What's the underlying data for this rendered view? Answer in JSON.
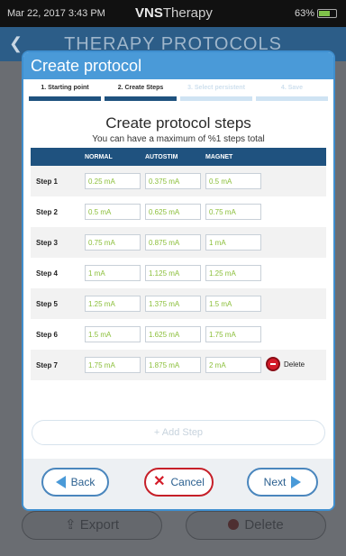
{
  "status_bar": {
    "datetime": "Mar 22, 2017  3:43 PM",
    "brand_prefix": "VNS",
    "brand_suffix": "Therapy",
    "battery": "63%"
  },
  "background": {
    "title": "THERAPY PROTOCOLS",
    "export_label": "Export",
    "delete_label": "Delete"
  },
  "modal": {
    "title": "Create protocol",
    "wizard_steps": [
      "1. Starting point",
      "2. Create Steps",
      "3. Select persistent",
      "4. Save"
    ],
    "heading": "Create protocol steps",
    "subheading": "You can have a maximum of %1 steps total",
    "columns": [
      "NORMAL",
      "AUTOSTIM",
      "MAGNET"
    ],
    "rows": [
      {
        "label": "Step 1",
        "normal": "0.25 mA",
        "autostim": "0.375 mA",
        "magnet": "0.5 mA"
      },
      {
        "label": "Step 2",
        "normal": "0.5 mA",
        "autostim": "0.625 mA",
        "magnet": "0.75 mA"
      },
      {
        "label": "Step 3",
        "normal": "0.75 mA",
        "autostim": "0.875 mA",
        "magnet": "1 mA"
      },
      {
        "label": "Step 4",
        "normal": "1 mA",
        "autostim": "1.125 mA",
        "magnet": "1.25 mA"
      },
      {
        "label": "Step 5",
        "normal": "1.25 mA",
        "autostim": "1.375 mA",
        "magnet": "1.5 mA"
      },
      {
        "label": "Step 6",
        "normal": "1.5 mA",
        "autostim": "1.625 mA",
        "magnet": "1.75 mA"
      },
      {
        "label": "Step 7",
        "normal": "1.75 mA",
        "autostim": "1.875 mA",
        "magnet": "2 mA"
      }
    ],
    "delete_label": "Delete",
    "add_step_label": "+ Add Step",
    "back_label": "Back",
    "cancel_label": "Cancel",
    "next_label": "Next"
  }
}
